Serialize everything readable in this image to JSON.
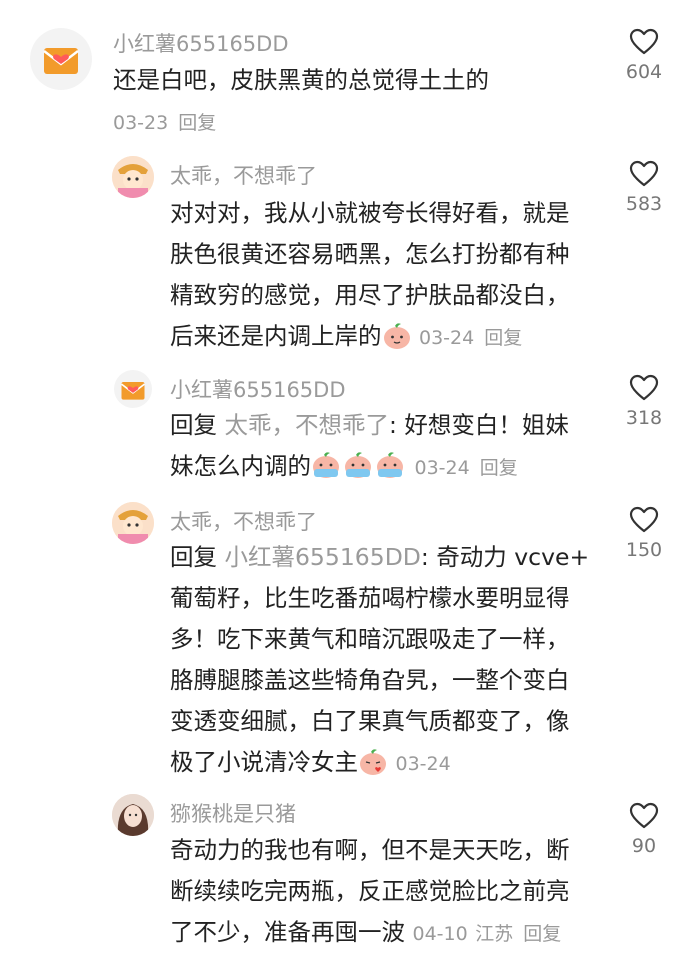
{
  "comments": [
    {
      "user": "小红薯655165DD",
      "text": "还是白吧，皮肤黑黄的总觉得土土的",
      "date": "03-23",
      "reply_label": "回复",
      "likes": "604",
      "avatar_icon": "envelope-heart-icon"
    },
    {
      "user": "太乖，不想乖了",
      "text_lines": [
        "对对对，我从小就被夸长得好看，就是",
        "肤色很黄还容易晒黑，怎么打扮都有种",
        "精致穷的感觉，用尽了护肤品都没白，",
        "后来还是内调上岸的"
      ],
      "date": "03-24",
      "reply_label": "回复",
      "likes": "583",
      "avatar_icon": "cartoon-girl-icon"
    },
    {
      "user": "小红薯655165DD",
      "reply_prefix": "回复",
      "reply_to": "太乖，不想乖了",
      "text_first": ": 好想变白！姐妹",
      "text_second": "妹怎么内调的",
      "date": "03-24",
      "reply_label": "回复",
      "likes": "318",
      "avatar_icon": "envelope-heart-icon"
    },
    {
      "user": "太乖，不想乖了",
      "reply_prefix": "回复",
      "reply_to": "小红薯655165DD",
      "text_first": ": 奇动力 vcve+",
      "text_lines": [
        "葡萄籽，比生吃番茄喝柠檬水要明显得",
        "多！吃下来黄气和暗沉跟吸走了一样，",
        "胳膊腿膝盖这些犄角旮旯，一整个变白",
        "变透变细腻，白了果真气质都变了，像"
      ],
      "text_last": "极了小说清冷女主",
      "date": "03-24",
      "reply_label": "回复",
      "likes": "150",
      "avatar_icon": "cartoon-girl-icon"
    },
    {
      "user": "猕猴桃是只猪",
      "text_lines": [
        "奇动力的我也有啊，但不是天天吃，断",
        "断续续吃完两瓶，反正感觉脸比之前亮"
      ],
      "text_last": "了不少，准备再囤一波",
      "date": "04-10",
      "location": "江苏",
      "reply_label": "回复",
      "likes": "90",
      "avatar_icon": "user-photo-avatar"
    }
  ]
}
